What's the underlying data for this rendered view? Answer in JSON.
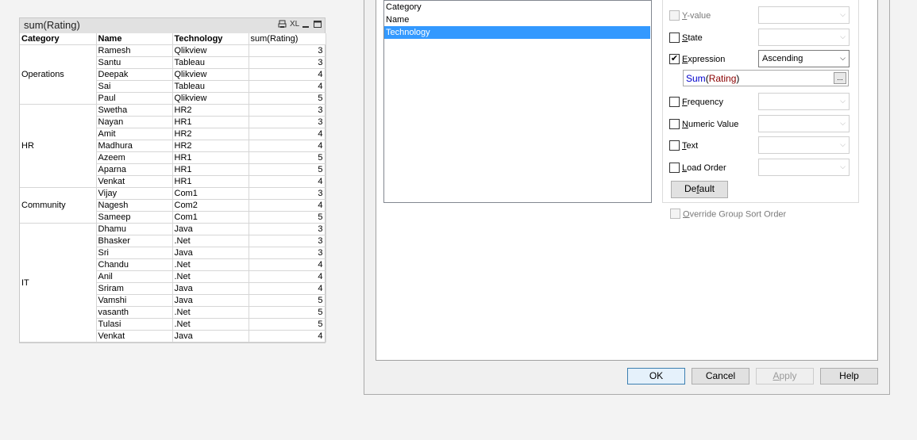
{
  "table": {
    "caption": "sum(Rating)",
    "caption_icons": [
      "print-icon",
      "excel-icon",
      "minimize-icon",
      "maximize-icon"
    ],
    "caption_icon_text": {
      "excel": "XL"
    },
    "headers": [
      "Category",
      "Name",
      "Technology",
      "sum(Rating)"
    ],
    "groups": [
      {
        "category": "Operations",
        "rows": [
          [
            "Ramesh",
            "Qlikview",
            "3"
          ],
          [
            "Santu",
            "Tableau",
            "3"
          ],
          [
            "Deepak",
            "Qlikview",
            "4"
          ],
          [
            "Sai",
            "Tableau",
            "4"
          ],
          [
            "Paul",
            "Qlikview",
            "5"
          ]
        ]
      },
      {
        "category": "HR",
        "rows": [
          [
            "Swetha",
            "HR2",
            "3"
          ],
          [
            "Nayan",
            "HR1",
            "3"
          ],
          [
            "Amit",
            "HR2",
            "4"
          ],
          [
            "Madhura",
            "HR2",
            "4"
          ],
          [
            "Azeem",
            "HR1",
            "5"
          ],
          [
            "Aparna",
            "HR1",
            "5"
          ],
          [
            "Venkat",
            "HR1",
            "4"
          ]
        ]
      },
      {
        "category": "Community",
        "rows": [
          [
            "Vijay",
            "Com1",
            "3"
          ],
          [
            "Nagesh",
            "Com2",
            "4"
          ],
          [
            "Sameep",
            "Com1",
            "5"
          ]
        ]
      },
      {
        "category": "IT",
        "rows": [
          [
            "Dhamu",
            "Java",
            "3"
          ],
          [
            "Bhasker",
            ".Net",
            "3"
          ],
          [
            "Sri",
            "Java",
            "3"
          ],
          [
            "Chandu",
            ".Net",
            "4"
          ],
          [
            "Anil",
            ".Net",
            "4"
          ],
          [
            "Sriram",
            "Java",
            "4"
          ],
          [
            "Vamshi",
            "Java",
            "5"
          ],
          [
            "vasanth",
            ".Net",
            "5"
          ],
          [
            "Tulasi",
            ".Net",
            "5"
          ],
          [
            "Venkat",
            "Java",
            "4"
          ]
        ]
      }
    ]
  },
  "dialog": {
    "sort_list": [
      {
        "label": "Category",
        "selected": false
      },
      {
        "label": "Name",
        "selected": false
      },
      {
        "label": "Technology",
        "selected": true
      }
    ],
    "criteria": {
      "y_value": {
        "label": "Y-value",
        "underline": "Y",
        "checked": false,
        "enabled": false
      },
      "state": {
        "label": "State",
        "underline": "S",
        "checked": false,
        "enabled": true
      },
      "expression": {
        "label": "Expression",
        "underline": "E",
        "checked": true,
        "enabled": true,
        "order": "Ascending"
      },
      "expression_text": {
        "fn": "Sum",
        "arg": "Rating"
      },
      "expression_button": "...",
      "frequency": {
        "label": "Frequency",
        "underline": "F",
        "checked": false,
        "enabled": true
      },
      "numeric_value": {
        "label": "Numeric Value",
        "underline": "N",
        "checked": false,
        "enabled": true
      },
      "text": {
        "label": "Text",
        "underline": "T",
        "checked": false,
        "enabled": true
      },
      "load_order": {
        "label": "Load Order",
        "underline": "L",
        "checked": false,
        "enabled": true
      }
    },
    "default_button": "Default",
    "override": {
      "label": "Override Group Sort Order",
      "underline": "O",
      "checked": false,
      "enabled": false
    },
    "buttons": {
      "ok": "OK",
      "cancel": "Cancel",
      "apply": "Apply",
      "help": "Help"
    }
  }
}
